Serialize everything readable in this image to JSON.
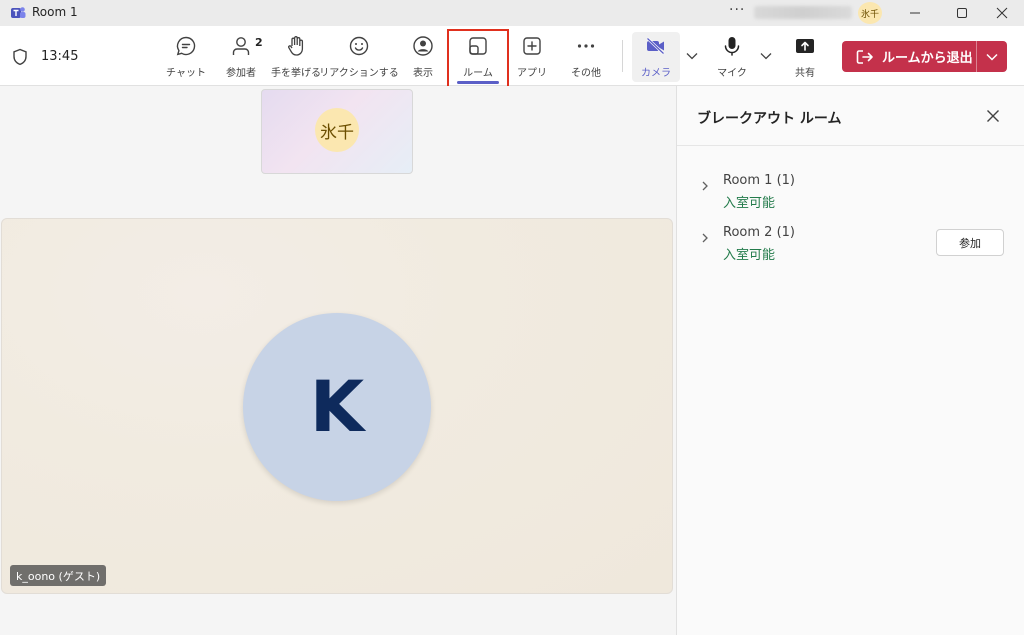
{
  "window": {
    "title": "Room 1",
    "more_label": "···",
    "avatar_initials": "氷千"
  },
  "toolbar": {
    "time": "13:45",
    "items": [
      {
        "id": "chat",
        "label": "チャット",
        "icon": "chat-icon"
      },
      {
        "id": "participants",
        "label": "参加者",
        "icon": "people-icon",
        "count": "2"
      },
      {
        "id": "raise-hand",
        "label": "手を挙げる",
        "icon": "hand-icon"
      },
      {
        "id": "reactions",
        "label": "リアクションする",
        "icon": "smiley-icon"
      },
      {
        "id": "view",
        "label": "表示",
        "icon": "view-icon"
      },
      {
        "id": "rooms",
        "label": "ルーム",
        "icon": "rooms-icon",
        "active": true
      },
      {
        "id": "apps",
        "label": "アプリ",
        "icon": "plus-square-icon"
      },
      {
        "id": "more",
        "label": "その他",
        "icon": "more-icon"
      },
      {
        "id": "camera",
        "label": "カメラ",
        "icon": "camera-off-icon"
      },
      {
        "id": "mic",
        "label": "マイク",
        "icon": "mic-icon"
      },
      {
        "id": "share",
        "label": "共有",
        "icon": "share-icon"
      }
    ],
    "leave_label": "ルームから退出",
    "accent": "#5b5fc7",
    "leave_color": "#c4314b",
    "highlight_color": "#e0301e"
  },
  "stage": {
    "small_tile_initials": "氷千",
    "big_tile_initial": "K",
    "big_tile_name": "k_oono (ゲスト)"
  },
  "panel": {
    "title": "ブレークアウト ルーム",
    "rooms": [
      {
        "name": "Room 1",
        "count": "(1)",
        "status": "入室可能"
      },
      {
        "name": "Room 2",
        "count": "(1)",
        "status": "入室可能",
        "action": "参加"
      }
    ],
    "status_color": "#237b4b"
  }
}
